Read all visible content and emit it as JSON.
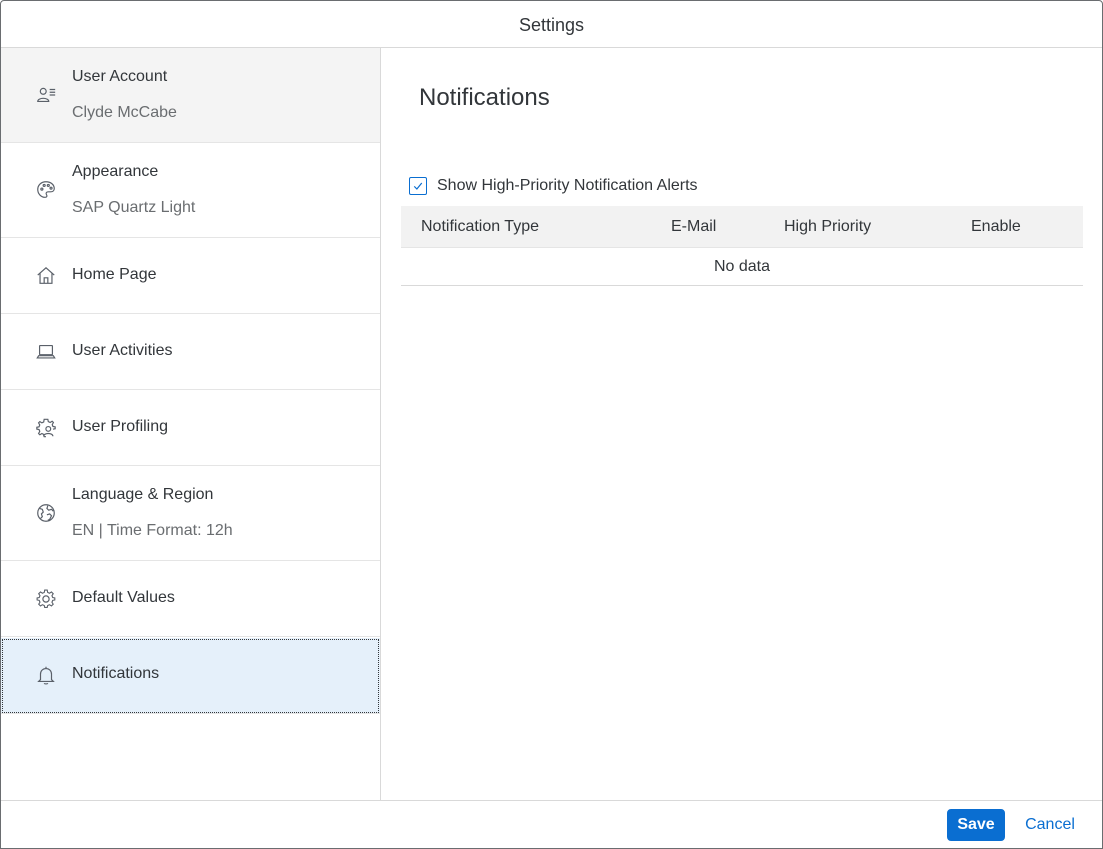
{
  "dialog": {
    "title": "Settings"
  },
  "sidebar": {
    "items": [
      {
        "id": "user-account",
        "title": "User Account",
        "subtitle": "Clyde McCabe",
        "icon": "user-account-icon"
      },
      {
        "id": "appearance",
        "title": "Appearance",
        "subtitle": "SAP Quartz Light",
        "icon": "palette-icon"
      },
      {
        "id": "home-page",
        "title": "Home Page",
        "icon": "home-icon"
      },
      {
        "id": "user-activities",
        "title": "User Activities",
        "icon": "laptop-icon"
      },
      {
        "id": "user-profiling",
        "title": "User Profiling",
        "icon": "user-settings-icon"
      },
      {
        "id": "language-region",
        "title": "Language & Region",
        "subtitle": "EN | Time Format: 12h",
        "icon": "globe-icon"
      },
      {
        "id": "default-values",
        "title": "Default Values",
        "icon": "gear-icon"
      },
      {
        "id": "notifications",
        "title": "Notifications",
        "icon": "bell-icon"
      }
    ],
    "selected": "notifications"
  },
  "content": {
    "title": "Notifications",
    "checkbox": {
      "label": "Show High-Priority Notification Alerts",
      "checked": true
    },
    "table": {
      "columns": [
        "Notification Type",
        "E-Mail",
        "High Priority",
        "Enable"
      ],
      "rows": [],
      "empty_text": "No data"
    }
  },
  "footer": {
    "save_label": "Save",
    "cancel_label": "Cancel"
  },
  "colors": {
    "accent": "#0a6ed1",
    "selected_background": "#e5f0fa",
    "header_row_background": "#f2f2f2"
  }
}
